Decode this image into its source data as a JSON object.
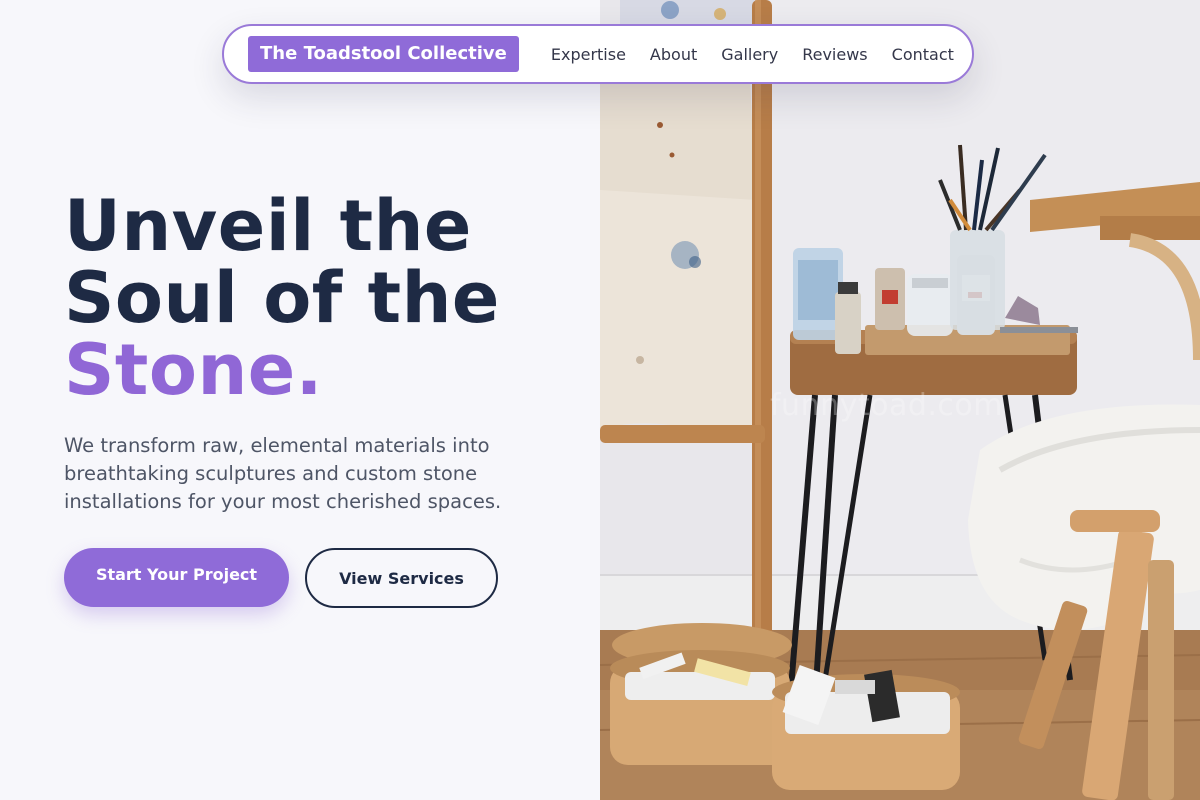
{
  "nav": {
    "brand": "The Toadstool Collective",
    "links": [
      "Expertise",
      "About",
      "Gallery",
      "Reviews",
      "Contact"
    ]
  },
  "hero": {
    "title_line1": "Unveil the",
    "title_line2": "Soul of the",
    "title_accent": "Stone.",
    "subtitle": "We transform raw, elemental materials into breathtaking sculptures and custom stone installations for your most cherished spaces.",
    "primary_cta": "Start Your Project",
    "secondary_cta": "View Services"
  },
  "image": {
    "watermark": "funnytoad.com"
  },
  "colors": {
    "accent": "#8f6bd8",
    "heading": "#1e2a44",
    "body_text": "#4e5566",
    "background": "#f7f7fb"
  }
}
